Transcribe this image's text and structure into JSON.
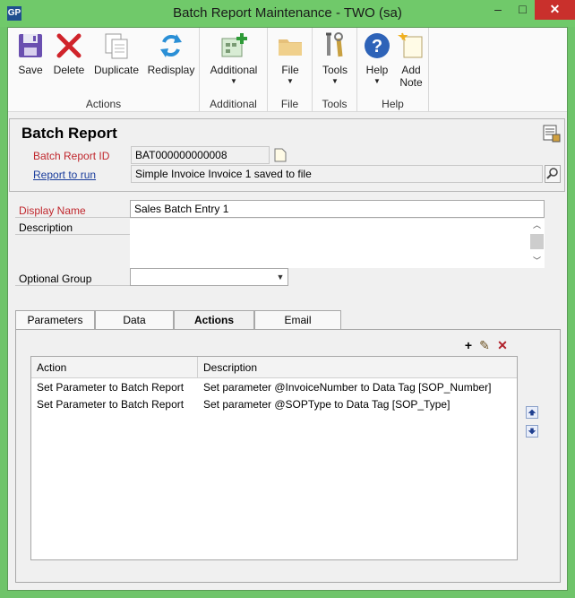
{
  "window": {
    "title": "Batch Report Maintenance  -  TWO (sa)",
    "logo": "GP",
    "minimize": "–",
    "maximize": "□",
    "close": "✕"
  },
  "ribbon": {
    "groups": [
      {
        "label": "Actions",
        "buttons": [
          {
            "label": "Save",
            "icon": "save-icon"
          },
          {
            "label": "Delete",
            "icon": "delete-icon"
          },
          {
            "label": "Duplicate",
            "icon": "duplicate-icon"
          },
          {
            "label": "Redisplay",
            "icon": "redisplay-icon"
          }
        ]
      },
      {
        "label": "Additional",
        "buttons": [
          {
            "label": "Additional",
            "icon": "additional-icon",
            "dropdown": true
          }
        ]
      },
      {
        "label": "File",
        "buttons": [
          {
            "label": "File",
            "icon": "folder-icon",
            "dropdown": true
          }
        ]
      },
      {
        "label": "Tools",
        "buttons": [
          {
            "label": "Tools",
            "icon": "tools-icon",
            "dropdown": true
          }
        ]
      },
      {
        "label": "Help",
        "buttons": [
          {
            "label": "Help",
            "icon": "help-icon",
            "dropdown": true
          },
          {
            "label": "Add Note",
            "label_line1": "Add",
            "label_line2": "Note",
            "icon": "note-icon"
          }
        ]
      }
    ]
  },
  "header": {
    "title": "Batch Report",
    "batch_report_id_label": "Batch Report ID",
    "batch_report_id_value": "BAT000000000008",
    "report_to_run_label": "Report to run",
    "report_to_run_value": "Simple Invoice Invoice 1 saved to file"
  },
  "form": {
    "display_name_label": "Display Name",
    "display_name_value": "Sales Batch Entry 1",
    "description_label": "Description",
    "description_value": "",
    "optional_group_label": "Optional Group",
    "optional_group_value": ""
  },
  "tabs": [
    {
      "label": "Parameters",
      "active": false
    },
    {
      "label": "Data",
      "active": false
    },
    {
      "label": "Actions",
      "active": true
    },
    {
      "label": "Email",
      "active": false
    }
  ],
  "actions_grid": {
    "toolbar": {
      "add": "+",
      "edit": "✎",
      "delete": "✕"
    },
    "columns": [
      "Action",
      "Description"
    ],
    "rows": [
      {
        "action": "Set Parameter to Batch Report",
        "description": "Set parameter @InvoiceNumber to Data Tag [SOP_Number]"
      },
      {
        "action": "Set Parameter to Batch Report",
        "description": "Set parameter @SOPType to Data Tag [SOP_Type]"
      }
    ]
  },
  "colors": {
    "window_frame": "#6fc46a",
    "required_label": "#c0272d",
    "link": "#1a3d9c",
    "close_button": "#c9302c"
  }
}
